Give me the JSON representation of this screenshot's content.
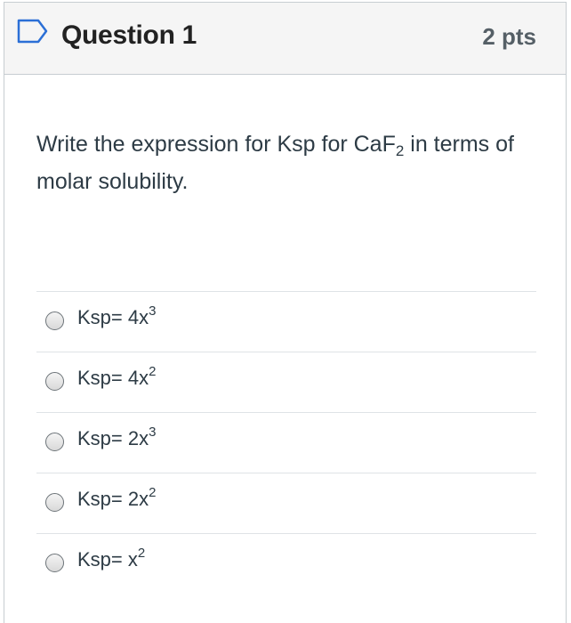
{
  "question": {
    "title": "Question 1",
    "points": "2 pts",
    "text_before": "Write the expression for  Ksp for CaF",
    "text_sub": "2",
    "text_after": " in terms of molar solubility."
  },
  "answers": [
    {
      "base": "Ksp= 4x",
      "exp": "3"
    },
    {
      "base": "Ksp= 4x",
      "exp": "2"
    },
    {
      "base": "Ksp= 2x",
      "exp": "3"
    },
    {
      "base": "Ksp= 2x",
      "exp": "2"
    },
    {
      "base": "Ksp= x",
      "exp": "2"
    }
  ],
  "icons": {
    "flag": "bookmark-flag-icon"
  },
  "colors": {
    "header_bg": "#f5f5f5",
    "border": "#c7cdd1",
    "text": "#2d3b45"
  }
}
